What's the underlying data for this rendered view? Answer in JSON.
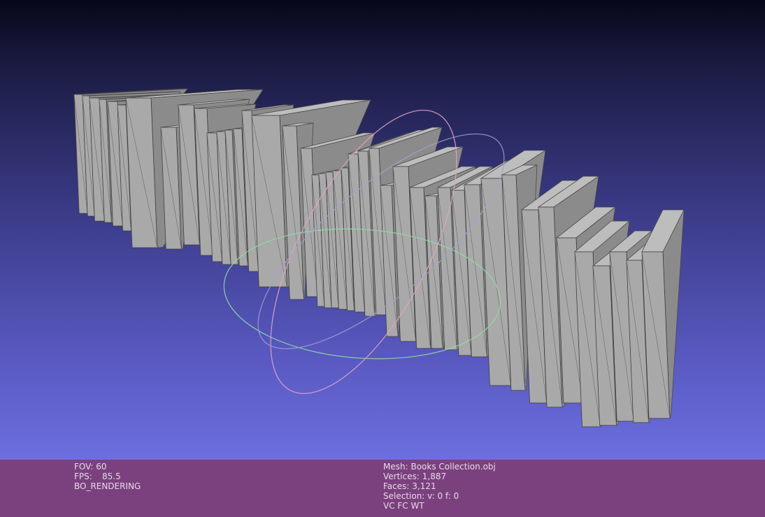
{
  "viewer": {
    "background_top": "#07071a",
    "background_bottom": "#6d6fe0",
    "mesh_color": "#a9a9a9",
    "trackball_colors": [
      "#e3a5c7",
      "#8fdca6",
      "#a7a1d0"
    ]
  },
  "info_left": {
    "fov_label": "FOV:",
    "fov_value": "60",
    "fps_label": "FPS:",
    "fps_value": "85.5",
    "mode": "BO_RENDERING"
  },
  "info_right": {
    "mesh_label": "Mesh:",
    "mesh_name": "Books Collection.obj",
    "vertices_label": "Vertices:",
    "vertices_value": "1,887",
    "faces_label": "Faces:",
    "faces_value": "3,121",
    "selection_label": "Selection:",
    "selection_value": "v: 0 f: 0",
    "flags": "VC FC WT"
  }
}
